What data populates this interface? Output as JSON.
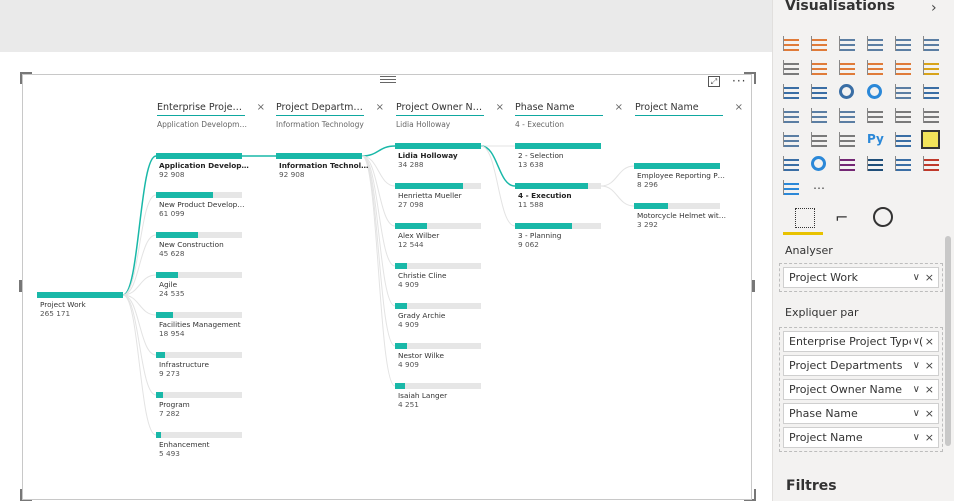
{
  "visual": {
    "columns": [
      {
        "title": "Enterprise Proje…",
        "subtitle": "Application Developm…"
      },
      {
        "title": "Project Departm…",
        "subtitle": "Information Technology"
      },
      {
        "title": "Project Owner N…",
        "subtitle": "Lidia Holloway"
      },
      {
        "title": "Phase Name",
        "subtitle": "4 - Execution"
      },
      {
        "title": "Project Name",
        "subtitle": ""
      }
    ],
    "close_glyph": "×",
    "root": {
      "label": "Project Work",
      "value": "265 171",
      "fraction": 1.0
    },
    "level1": [
      {
        "label": "Application Develop…",
        "value": "92 908",
        "fraction": 1.0,
        "selected": true
      },
      {
        "label": "New Product Develop…",
        "value": "61 099",
        "fraction": 0.66
      },
      {
        "label": "New Construction",
        "value": "45 628",
        "fraction": 0.49
      },
      {
        "label": "Agile",
        "value": "24 535",
        "fraction": 0.26
      },
      {
        "label": "Facilities Management",
        "value": "18 954",
        "fraction": 0.2
      },
      {
        "label": "Infrastructure",
        "value": "9 273",
        "fraction": 0.1
      },
      {
        "label": "Program",
        "value": "7 282",
        "fraction": 0.08
      },
      {
        "label": "Enhancement",
        "value": "5 493",
        "fraction": 0.06
      }
    ],
    "level2": [
      {
        "label": "Information Technol…",
        "value": "92 908",
        "fraction": 1.0,
        "selected": true
      }
    ],
    "level3": [
      {
        "label": "Lidia Holloway",
        "value": "34 288",
        "fraction": 1.0,
        "selected": true
      },
      {
        "label": "Henrietta Mueller",
        "value": "27 098",
        "fraction": 0.79
      },
      {
        "label": "Alex Wilber",
        "value": "12 544",
        "fraction": 0.37
      },
      {
        "label": "Christie Cline",
        "value": "4 909",
        "fraction": 0.14
      },
      {
        "label": "Grady Archie",
        "value": "4 909",
        "fraction": 0.14
      },
      {
        "label": "Nestor Wilke",
        "value": "4 909",
        "fraction": 0.14
      },
      {
        "label": "Isaiah Langer",
        "value": "4 251",
        "fraction": 0.12
      }
    ],
    "level4": [
      {
        "label": "2 - Selection",
        "value": "13 638",
        "fraction": 1.0
      },
      {
        "label": "4 - Execution",
        "value": "11 588",
        "fraction": 0.85,
        "selected": true
      },
      {
        "label": "3 - Planning",
        "value": "9 062",
        "fraction": 0.66
      }
    ],
    "level5": [
      {
        "label": "Employee Reporting P…",
        "value": "8 296",
        "fraction": 1.0
      },
      {
        "label": "Motorcycle Helmet wit…",
        "value": "3 292",
        "fraction": 0.4
      }
    ]
  },
  "pane": {
    "title": "Visualisations",
    "analyse_label": "Analyser",
    "analyse_fields": [
      "Project Work"
    ],
    "explain_label": "Expliquer par",
    "explain_fields": [
      "Enterprise Project Type (",
      "Project Departments",
      "Project Owner Name",
      "Phase Name",
      "Project Name"
    ],
    "filters_label": "Filtres",
    "more_glyph": "…"
  },
  "colors": {
    "accent": "#19b8a8",
    "track": "#e6e6e6",
    "highlight": "#e8c200"
  }
}
